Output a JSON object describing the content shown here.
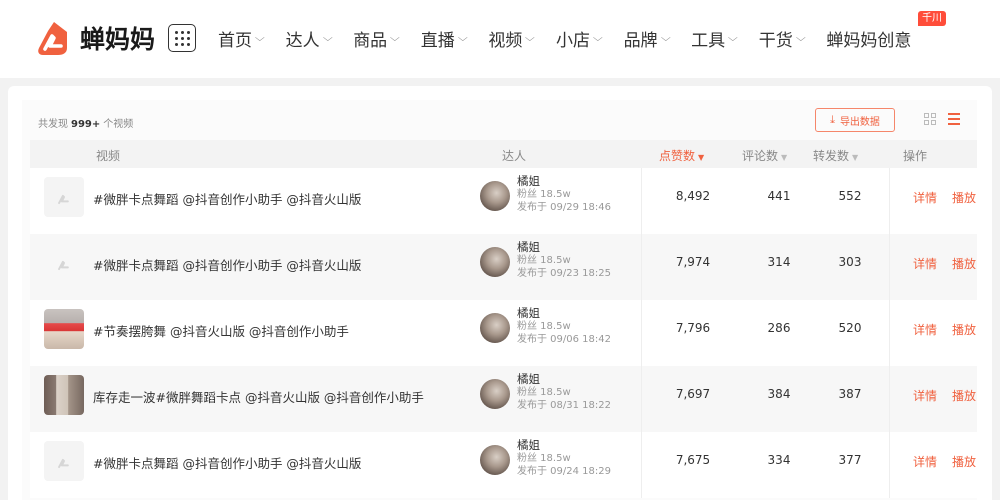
{
  "brand": {
    "name": "蝉妈妈",
    "accent": "#f0613f"
  },
  "nav": {
    "items": [
      {
        "label": "首页"
      },
      {
        "label": "达人"
      },
      {
        "label": "商品"
      },
      {
        "label": "直播"
      },
      {
        "label": "视频"
      },
      {
        "label": "小店"
      },
      {
        "label": "品牌"
      },
      {
        "label": "工具"
      },
      {
        "label": "干货"
      },
      {
        "label": "蝉妈妈创意"
      }
    ],
    "badge": "千川"
  },
  "summary": {
    "prefix": "共发现",
    "count": "999+",
    "suffix": "个视频"
  },
  "export_label": "导出数据",
  "table": {
    "headers": {
      "video": "视频",
      "talent": "达人",
      "likes": "点赞数",
      "comments": "评论数",
      "shares": "转发数",
      "actions": "操作"
    },
    "rows": [
      {
        "thumb": "logo",
        "title": "#微胖卡点舞蹈 @抖音创作小助手 @抖音火山版",
        "name": "橘姐",
        "fans": "粉丝 18.5w",
        "published": "发布于 09/29 18:46",
        "likes": "8,492",
        "comments": "441",
        "shares": "552",
        "detail": "详情",
        "play": "播放"
      },
      {
        "thumb": "logo",
        "title": "#微胖卡点舞蹈 @抖音创作小助手 @抖音火山版",
        "name": "橘姐",
        "fans": "粉丝 18.5w",
        "published": "发布于 09/23 18:25",
        "likes": "7,974",
        "comments": "314",
        "shares": "303",
        "detail": "详情",
        "play": "播放"
      },
      {
        "thumb": "photo",
        "title": "#节奏摆胯舞 @抖音火山版 @抖音创作小助手",
        "name": "橘姐",
        "fans": "粉丝 18.5w",
        "published": "发布于 09/06 18:42",
        "likes": "7,796",
        "comments": "286",
        "shares": "520",
        "detail": "详情",
        "play": "播放"
      },
      {
        "thumb": "photo",
        "title": "库存走一波#微胖舞蹈卡点 @抖音火山版 @抖音创作小助手",
        "name": "橘姐",
        "fans": "粉丝 18.5w",
        "published": "发布于 08/31 18:22",
        "likes": "7,697",
        "comments": "384",
        "shares": "387",
        "detail": "详情",
        "play": "播放"
      },
      {
        "thumb": "logo",
        "title": "#微胖卡点舞蹈 @抖音创作小助手 @抖音火山版",
        "name": "橘姐",
        "fans": "粉丝 18.5w",
        "published": "发布于 09/24 18:29",
        "likes": "7,675",
        "comments": "334",
        "shares": "377",
        "detail": "详情",
        "play": "播放"
      }
    ]
  }
}
